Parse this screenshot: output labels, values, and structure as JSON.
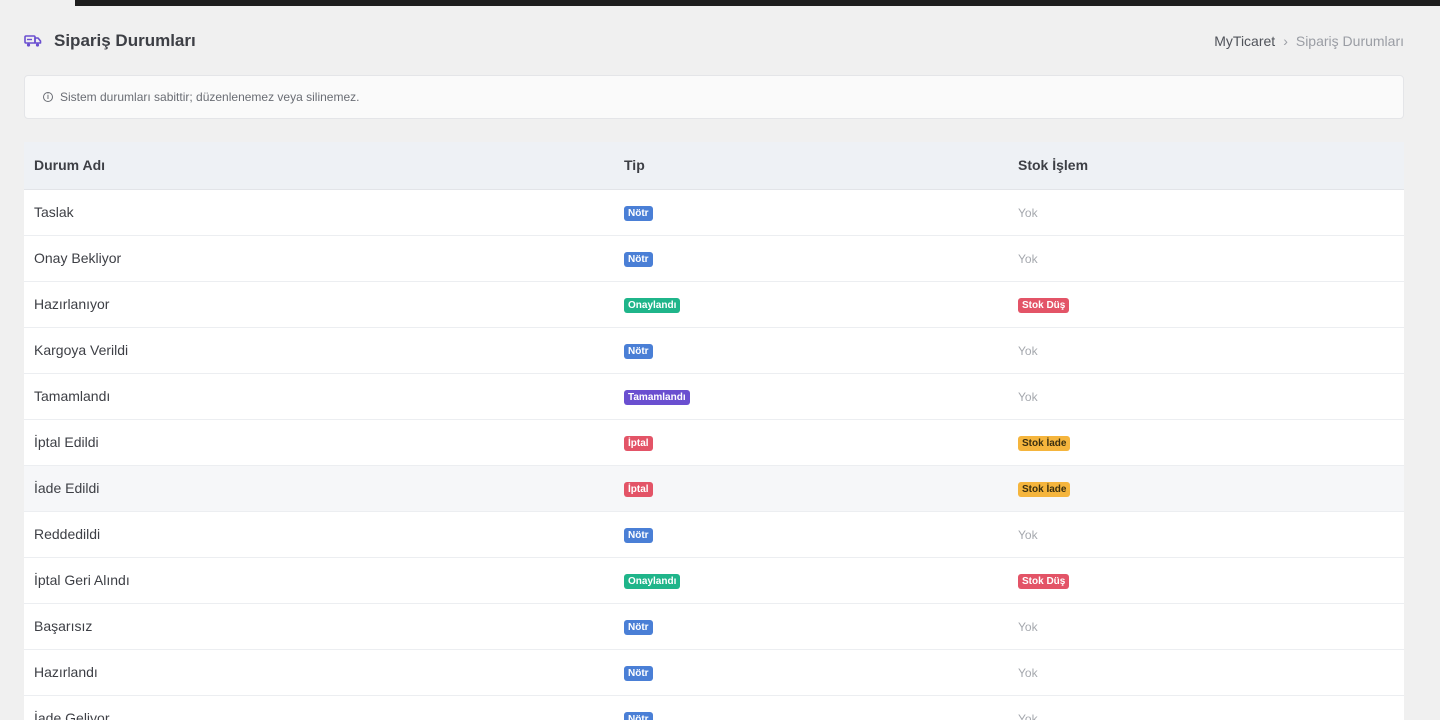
{
  "header": {
    "title": "Sipariş Durumları",
    "title_icon": "truck-icon",
    "breadcrumb": {
      "home": "MyTicaret",
      "separator": "›",
      "current": "Sipariş Durumları"
    }
  },
  "alert": {
    "icon": "info-icon",
    "text": "Sistem durumları sabittir; düzenlenemez veya silinemez."
  },
  "table": {
    "columns": [
      "Durum Adı",
      "Tip",
      "Stok İşlem"
    ],
    "rows": [
      {
        "name": "Taslak",
        "type": "Nötr",
        "type_kind": "notr",
        "stock": "Yok",
        "stock_kind": "none"
      },
      {
        "name": "Onay Bekliyor",
        "type": "Nötr",
        "type_kind": "notr",
        "stock": "Yok",
        "stock_kind": "none"
      },
      {
        "name": "Hazırlanıyor",
        "type": "Onaylandı",
        "type_kind": "onay",
        "stock": "Stok Düş",
        "stock_kind": "dus"
      },
      {
        "name": "Kargoya Verildi",
        "type": "Nötr",
        "type_kind": "notr",
        "stock": "Yok",
        "stock_kind": "none"
      },
      {
        "name": "Tamamlandı",
        "type": "Tamamlandı",
        "type_kind": "tamam",
        "stock": "Yok",
        "stock_kind": "none"
      },
      {
        "name": "İptal Edildi",
        "type": "İptal",
        "type_kind": "iptal",
        "stock": "Stok İade",
        "stock_kind": "iade"
      },
      {
        "name": "İade Edildi",
        "type": "İptal",
        "type_kind": "iptal",
        "stock": "Stok İade",
        "stock_kind": "iade"
      },
      {
        "name": "Reddedildi",
        "type": "Nötr",
        "type_kind": "notr",
        "stock": "Yok",
        "stock_kind": "none"
      },
      {
        "name": "İptal Geri Alındı",
        "type": "Onaylandı",
        "type_kind": "onay",
        "stock": "Stok Düş",
        "stock_kind": "dus"
      },
      {
        "name": "Başarısız",
        "type": "Nötr",
        "type_kind": "notr",
        "stock": "Yok",
        "stock_kind": "none"
      },
      {
        "name": "Hazırlandı",
        "type": "Nötr",
        "type_kind": "notr",
        "stock": "Yok",
        "stock_kind": "none"
      },
      {
        "name": "İade Geliyor",
        "type": "Nötr",
        "type_kind": "notr",
        "stock": "Yok",
        "stock_kind": "none"
      }
    ]
  },
  "colors": {
    "notr": "#4a7fd6",
    "onay": "#1fb58a",
    "tamam": "#6a4fd0",
    "iptal": "#e35467",
    "dus": "#e35467",
    "iade": "#f5b53d",
    "accent": "#6a4fd0"
  }
}
